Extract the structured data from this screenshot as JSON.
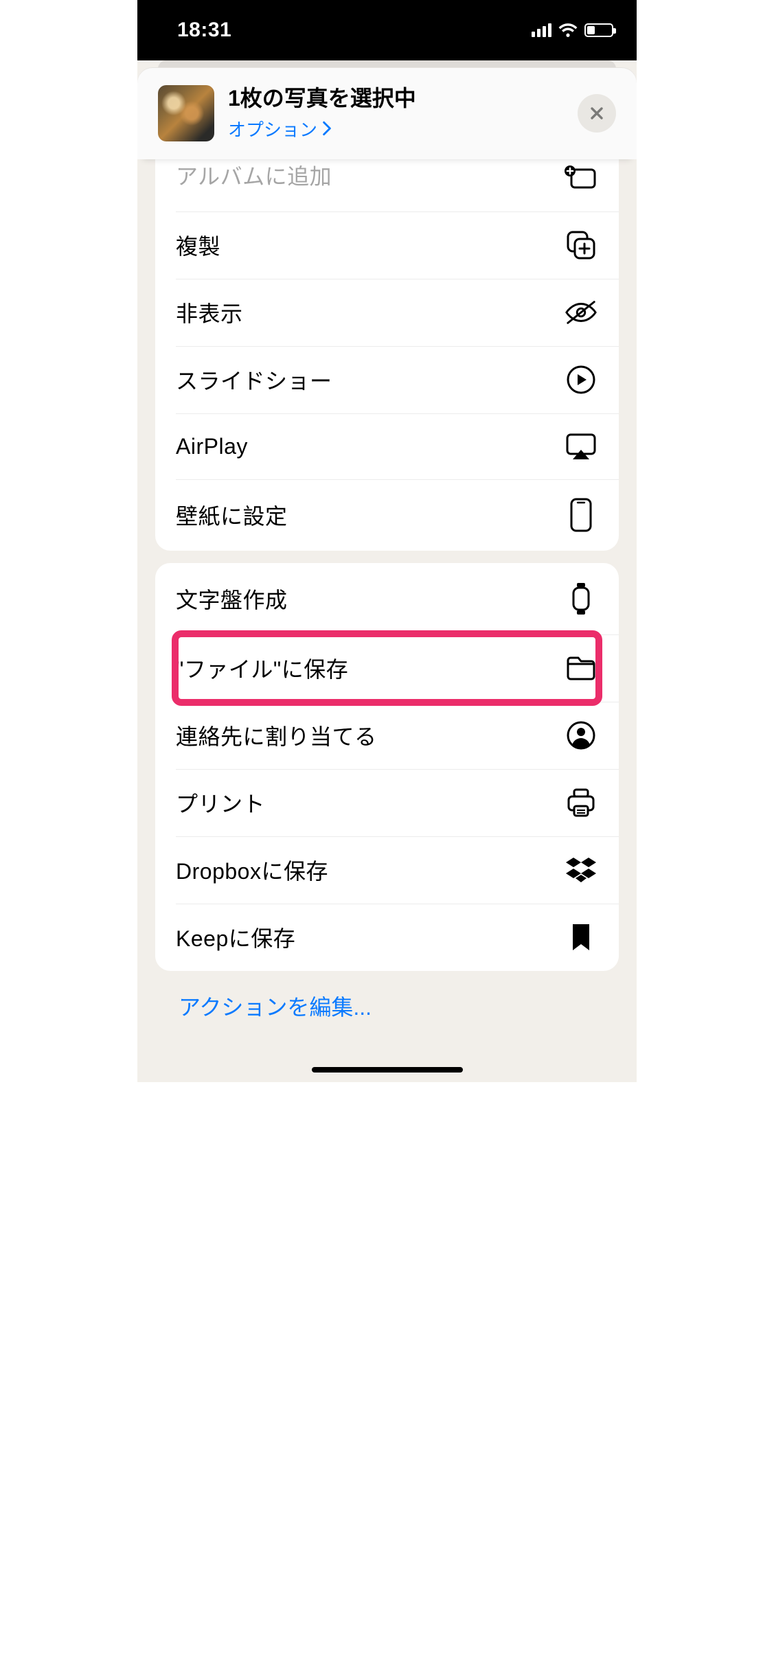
{
  "status": {
    "time": "18:31"
  },
  "header": {
    "title": "1枚の写真を選択中",
    "options": "オプション"
  },
  "group1": {
    "addToAlbum": "アルバムに追加",
    "duplicate": "複製",
    "hide": "非表示",
    "slideshow": "スライドショー",
    "airplay": "AirPlay",
    "wallpaper": "壁紙に設定"
  },
  "group2": {
    "watchFace": "文字盤作成",
    "saveToFiles": "\"ファイル\"に保存",
    "assignContact": "連絡先に割り当てる",
    "print": "プリント",
    "dropbox": "Dropboxに保存",
    "keep": "Keepに保存"
  },
  "footer": {
    "editActions": "アクションを編集..."
  },
  "highlight": {
    "target": "saveToFiles"
  }
}
